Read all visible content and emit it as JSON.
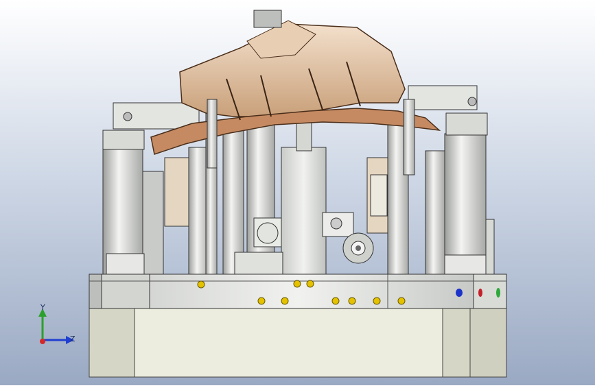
{
  "viewport": {
    "background_top": "#ffffff",
    "background_bottom": "#9aa9c3",
    "model": "fixture-assembly"
  },
  "triad": {
    "y_label": "Y",
    "z_label": "Z",
    "y_color": "#2ca02c",
    "z_color": "#1f3fd1",
    "x_color": "#d62728"
  },
  "indicators": {
    "blue": "#1b33c9",
    "red": "#c4202a",
    "green": "#2ea83a"
  }
}
